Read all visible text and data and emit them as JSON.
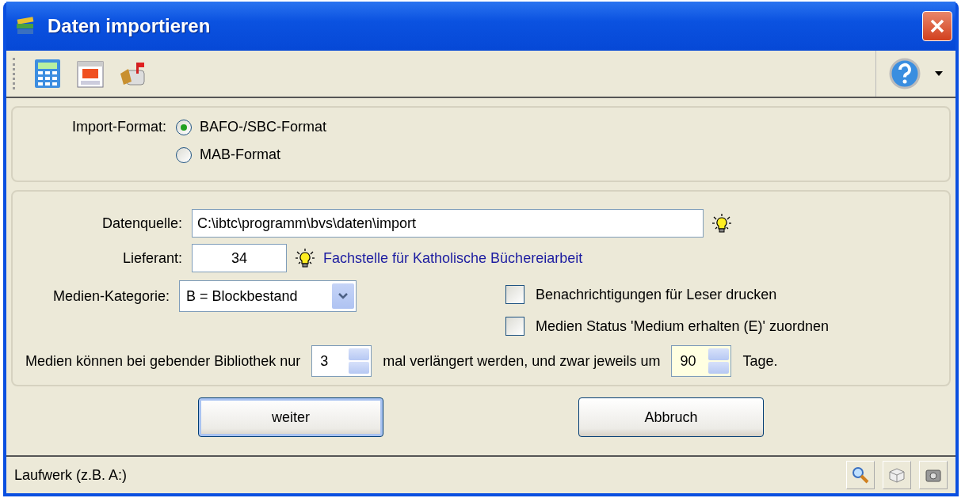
{
  "window": {
    "title": "Daten importieren"
  },
  "import_format": {
    "label": "Import-Format:",
    "options": [
      {
        "label": "BAFO-/SBC-Format",
        "selected": true
      },
      {
        "label": "MAB-Format",
        "selected": false
      }
    ]
  },
  "source": {
    "label": "Datenquelle:",
    "value": "C:\\ibtc\\programm\\bvs\\daten\\import"
  },
  "supplier": {
    "label": "Lieferant:",
    "value": "34",
    "name": "Fachstelle für Katholische Büchereiarbeit"
  },
  "category": {
    "label": "Medien-Kategorie:",
    "value": "B = Blockbestand"
  },
  "options": [
    {
      "label": "Benachrichtigungen für Leser drucken",
      "checked": false
    },
    {
      "label": "Medien Status 'Medium erhalten (E)' zuordnen",
      "checked": false
    }
  ],
  "renewal": {
    "text_1": "Medien können bei gebender Bibliothek nur",
    "count": {
      "value": "3",
      "focused": false
    },
    "text_2": "mal verlängert werden, und zwar jeweils um",
    "days": {
      "value": "90",
      "focused": true
    },
    "text_3": "Tage."
  },
  "buttons": [
    {
      "label": "weiter",
      "default": true
    },
    {
      "label": "Abbruch",
      "default": false
    }
  ],
  "status_bar": {
    "text": "Laufwerk (z.B. A:)"
  }
}
